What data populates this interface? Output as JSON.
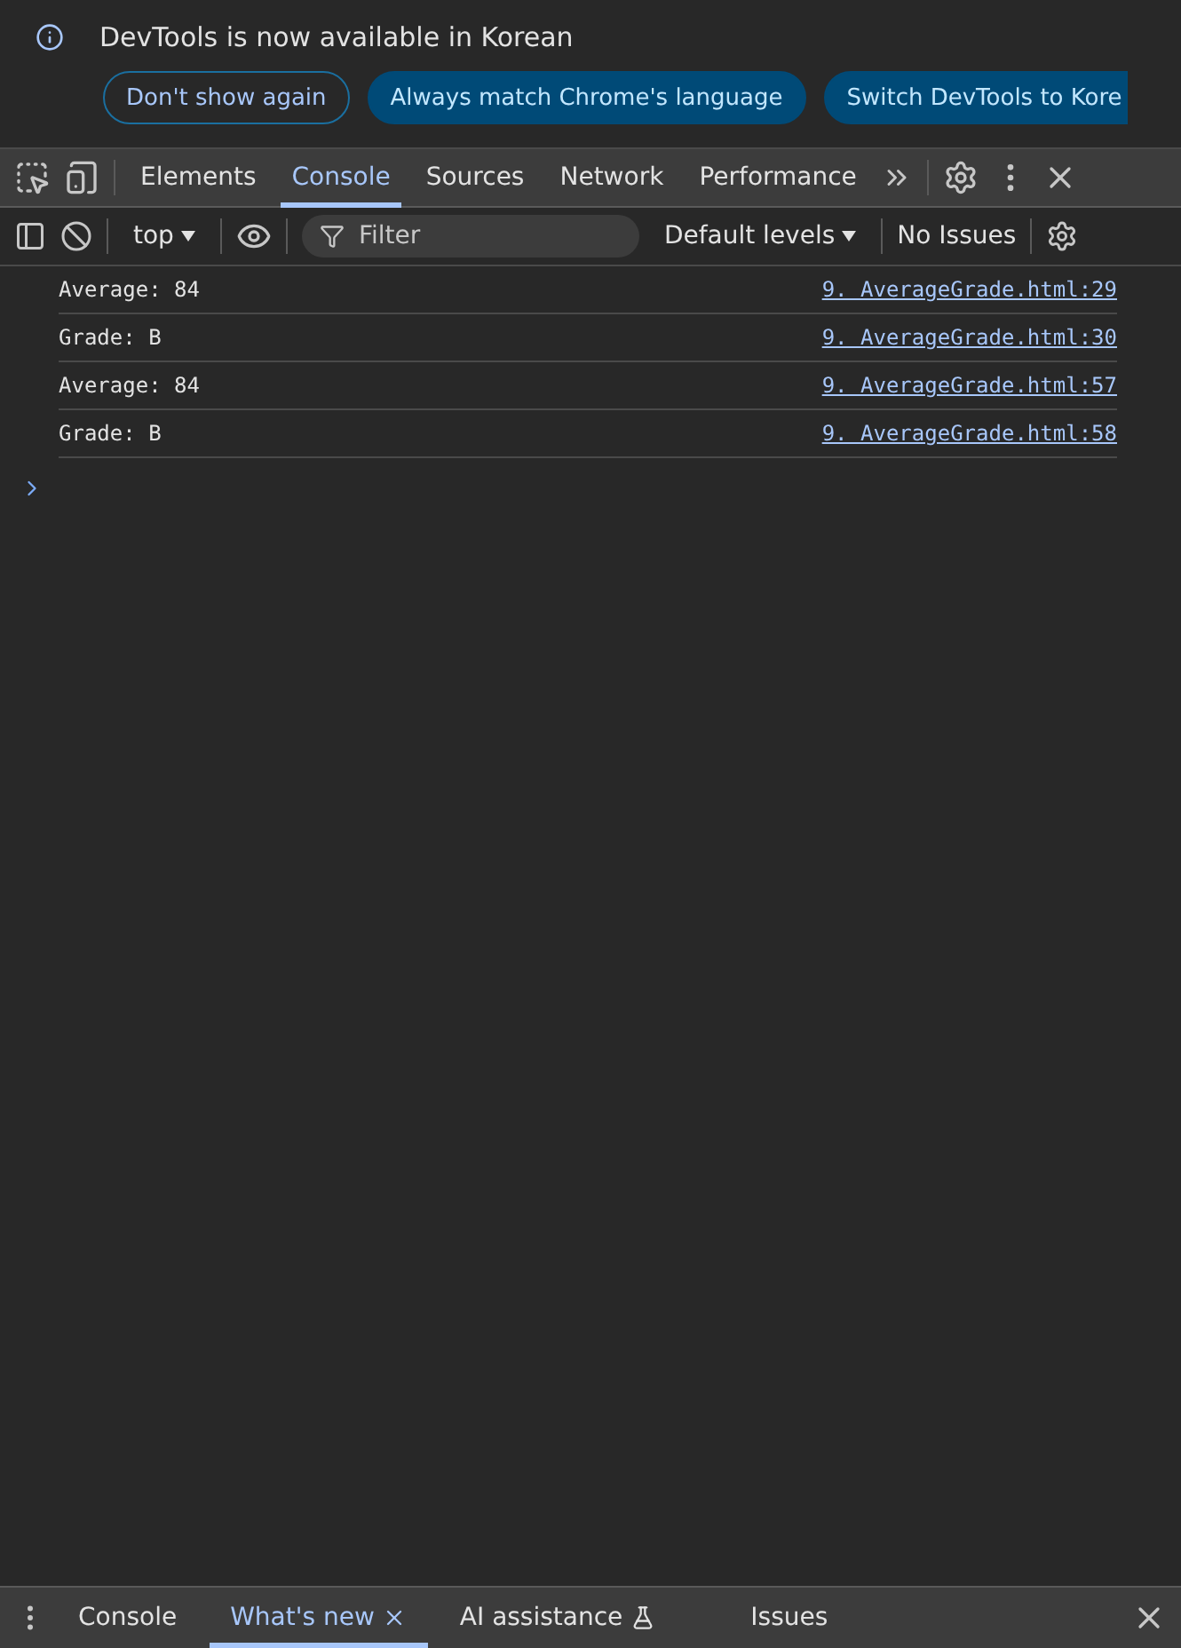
{
  "infobar": {
    "message": "DevTools is now available in Korean",
    "buttons": [
      {
        "label": "Don't show again",
        "kind": "outline"
      },
      {
        "label": "Always match Chrome's language",
        "kind": "filled"
      },
      {
        "label": "Switch DevTools to Kore",
        "kind": "filled"
      }
    ]
  },
  "main_tabs": [
    {
      "label": "Elements",
      "selected": false
    },
    {
      "label": "Console",
      "selected": true
    },
    {
      "label": "Sources",
      "selected": false
    },
    {
      "label": "Network",
      "selected": false
    },
    {
      "label": "Performance",
      "selected": false
    }
  ],
  "console_toolbar": {
    "context": "top",
    "filter_placeholder": "Filter",
    "levels": "Default levels",
    "issues": "No Issues"
  },
  "messages": [
    {
      "text": "Average: 84",
      "source": "9. AverageGrade.html:29"
    },
    {
      "text": "Grade: B",
      "source": "9. AverageGrade.html:30"
    },
    {
      "text": "Average: 84",
      "source": "9. AverageGrade.html:57"
    },
    {
      "text": "Grade: B",
      "source": "9. AverageGrade.html:58"
    }
  ],
  "drawer_tabs": [
    {
      "label": "Console",
      "selected": false,
      "kind": "plain"
    },
    {
      "label": "What's new",
      "selected": true,
      "kind": "closable"
    },
    {
      "label": "AI assistance",
      "selected": false,
      "kind": "experimental"
    },
    {
      "label": "Issues",
      "selected": false,
      "kind": "plain"
    }
  ]
}
